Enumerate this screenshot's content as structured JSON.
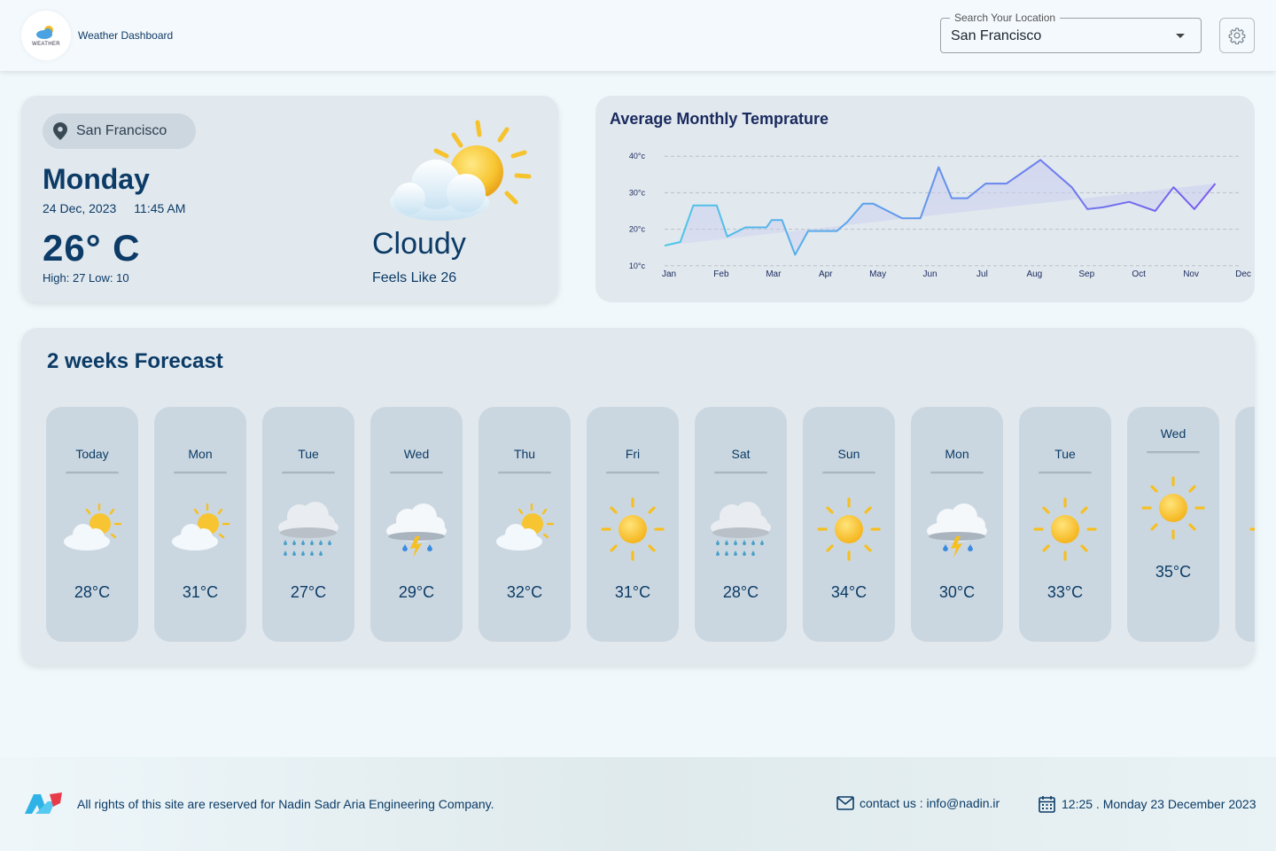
{
  "header": {
    "logo_text": "WEATHER",
    "app_title": "Weather Dashboard",
    "search": {
      "legend": "Search Your Location",
      "value": "San Francisco"
    }
  },
  "current": {
    "location": "San Francisco",
    "day": "Monday",
    "date": "24 Dec, 2023",
    "time": "11:45 AM",
    "temperature": "26° C",
    "high_low": "High: 27 Low: 10",
    "condition": "Cloudy",
    "feels_like": "Feels Like 26",
    "icon": "sun-behind-cloud-icon"
  },
  "chart_data": {
    "type": "area",
    "title": "Average Monthly Temprature",
    "categories": [
      "Jan",
      "Feb",
      "Mar",
      "Apr",
      "May",
      "Jun",
      "Jul",
      "Aug",
      "Sep",
      "Oct",
      "Nov",
      "Dec"
    ],
    "y_ticks": [
      "10°c",
      "20°c",
      "30°c",
      "40°c"
    ],
    "ylim": [
      8,
      42
    ],
    "x": [
      0,
      0.3,
      0.55,
      1.0,
      1.2,
      1.55,
      1.8,
      1.95,
      2.05,
      2.25,
      2.5,
      2.75,
      2.95,
      3.3,
      3.5,
      3.8,
      4.0,
      4.55,
      4.9,
      5.25,
      5.5,
      5.8,
      6.15,
      6.55,
      7.2,
      7.8,
      8.1,
      8.4,
      8.9,
      9.4,
      9.75,
      10.15,
      10.55,
      11.0
    ],
    "values": [
      15.5,
      16.5,
      26.5,
      26.5,
      18,
      20.5,
      20.5,
      20.5,
      22.5,
      22.5,
      13,
      19.5,
      19.5,
      19.5,
      22,
      27,
      27,
      23,
      23,
      37,
      28.5,
      28.5,
      32.5,
      32.5,
      39,
      31.5,
      25.5,
      26,
      27.5,
      25,
      31.5,
      25.5,
      32.5
    ],
    "grid": true,
    "legend": "none",
    "colors": {
      "start": "#4cc9e8",
      "end": "#7a5af0"
    }
  },
  "forecast": {
    "title": "2 weeks Forecast",
    "days": [
      {
        "day": "Today",
        "temp": "28°C",
        "icon": "sun-behind-cloud-icon"
      },
      {
        "day": "Mon",
        "temp": "31°C",
        "icon": "sun-behind-cloud-icon"
      },
      {
        "day": "Tue",
        "temp": "27°C",
        "icon": "rain-cloud-icon"
      },
      {
        "day": "Wed",
        "temp": "29°C",
        "icon": "thunderstorm-icon"
      },
      {
        "day": "Thu",
        "temp": "32°C",
        "icon": "sun-behind-cloud-icon"
      },
      {
        "day": "Fri",
        "temp": "31°C",
        "icon": "sun-icon"
      },
      {
        "day": "Sat",
        "temp": "28°C",
        "icon": "rain-cloud-icon"
      },
      {
        "day": "Sun",
        "temp": "34°C",
        "icon": "sun-icon"
      },
      {
        "day": "Mon",
        "temp": "30°C",
        "icon": "thunderstorm-icon"
      },
      {
        "day": "Tue",
        "temp": "33°C",
        "icon": "sun-icon"
      },
      {
        "day": "Wed",
        "temp": "35°C",
        "icon": "sun-icon"
      },
      {
        "day": "",
        "temp": "",
        "icon": "sun-icon"
      }
    ]
  },
  "footer": {
    "copyright": "All rights of this site are reserved for Nadin Sadr Aria Engineering Company.",
    "contact": "contact us : info@nadin.ir",
    "datetime": "12:25 . Monday 23 December 2023"
  }
}
